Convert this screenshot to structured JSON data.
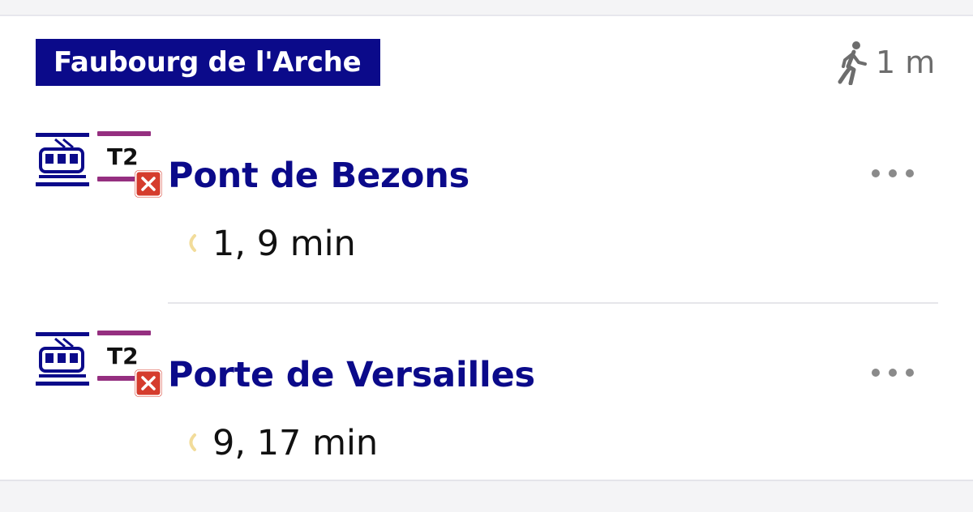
{
  "stop": {
    "name": "Faubourg de l'Arche"
  },
  "walk": {
    "icon": "walking-person-icon",
    "distance": "1 m"
  },
  "departures": [
    {
      "mode_icon": "tram-icon",
      "line": "T2",
      "line_color": "#952f80",
      "disruption_icon": "disruption-x-icon",
      "direction": "Pont de Bezons",
      "realtime_icon": "realtime-signal-icon",
      "times": "1, 9 min"
    },
    {
      "mode_icon": "tram-icon",
      "line": "T2",
      "line_color": "#952f80",
      "disruption_icon": "disruption-x-icon",
      "direction": "Porte de Versailles",
      "realtime_icon": "realtime-signal-icon",
      "times": "9, 17 min"
    }
  ],
  "colors": {
    "brand_navy": "#0b0a8a",
    "disruption_red": "#d53c2d",
    "line_t2": "#952f80"
  }
}
